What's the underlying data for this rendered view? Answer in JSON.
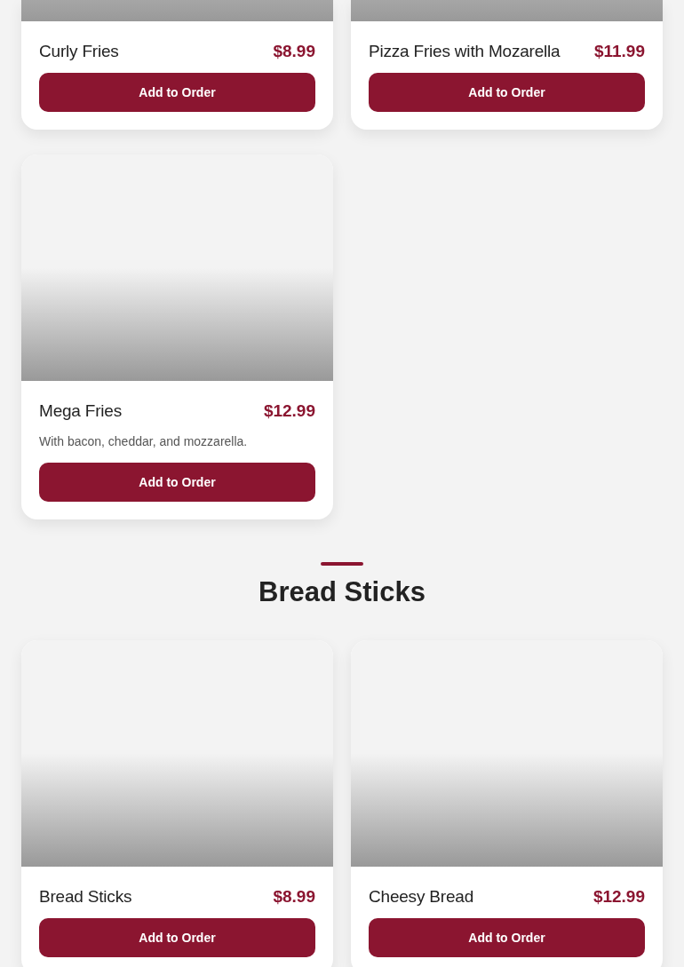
{
  "sections": [
    {
      "items": [
        {
          "name": "Curly Fries",
          "price": "$8.99",
          "button": "Add to Order"
        },
        {
          "name": "Pizza Fries with Mozarella",
          "price": "$11.99",
          "button": "Add to Order"
        },
        {
          "name": "Mega Fries",
          "price": "$12.99",
          "description": "With bacon, cheddar, and mozzarella.",
          "button": "Add to Order"
        }
      ]
    },
    {
      "title": "Bread Sticks",
      "items": [
        {
          "name": "Bread Sticks",
          "price": "$8.99",
          "button": "Add to Order"
        },
        {
          "name": "Cheesy Bread",
          "price": "$12.99",
          "button": "Add to Order"
        }
      ]
    }
  ]
}
